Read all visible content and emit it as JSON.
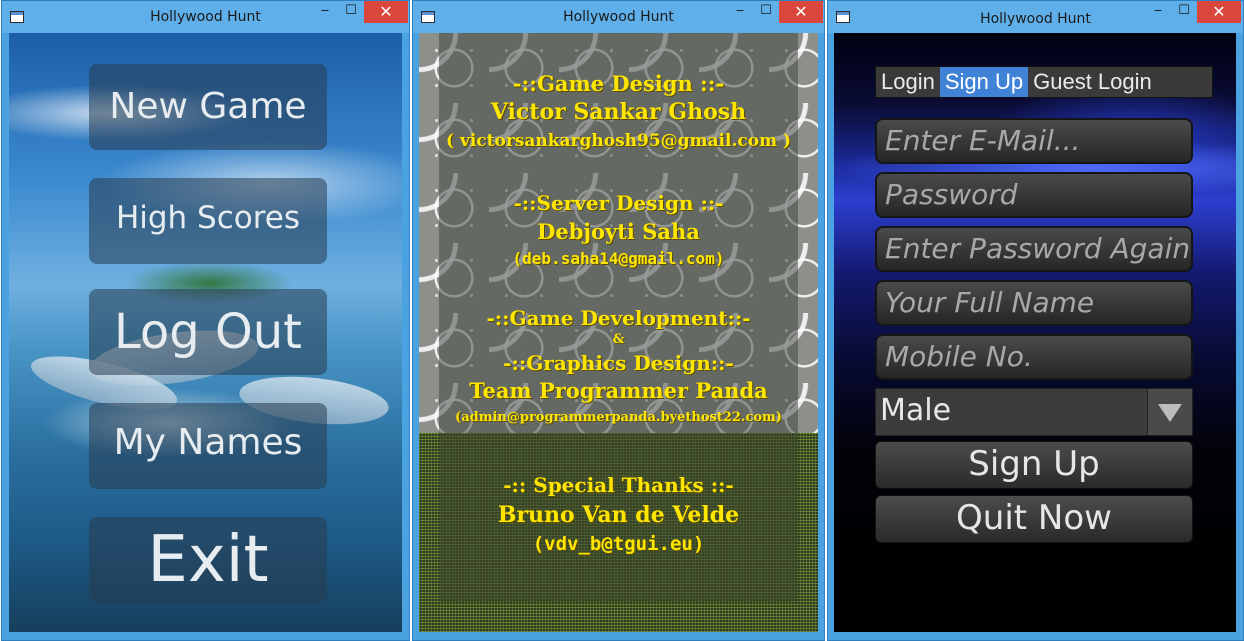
{
  "windows": [
    {
      "title": "Hollywood Hunt",
      "menu": [
        "New Game",
        "High Scores",
        "Log Out",
        "My Names",
        "Exit"
      ]
    },
    {
      "title": "Hollywood Hunt",
      "credits": [
        "-::Game Design ::-",
        "Victor Sankar Ghosh",
        "( victorsankarghosh95@gmail.com )",
        "-::Server Design ::-",
        "Debjoyti Saha",
        "(deb.saha14@gmail.com)",
        "-::Game Development::-",
        "&",
        "-::Graphics Design::-",
        "Team Programmer Panda",
        "(admin@programmerpanda.byethost22.com)",
        "-:: Special Thanks ::-",
        "Bruno Van de Velde",
        "(vdv_b@tgui.eu)"
      ]
    },
    {
      "title": "Hollywood Hunt",
      "tabs": [
        "Login",
        "Sign Up",
        "Guest Login"
      ],
      "active_tab": "Sign Up",
      "fields": [
        "Enter E-Mail...",
        "Password",
        "Enter Password Again",
        "Your Full Name",
        "Mobile No."
      ],
      "gender": "Male",
      "sign_up": "Sign Up",
      "quit": "Quit Now"
    }
  ],
  "controls": {
    "minimize": "‒",
    "maximize": "☐",
    "close": "✕"
  }
}
